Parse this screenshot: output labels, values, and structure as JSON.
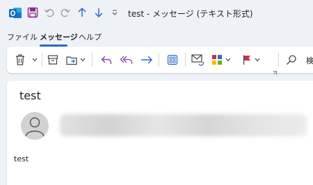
{
  "window": {
    "title": "test  -  メッセージ (テキスト形式)"
  },
  "quick_access": {
    "icons": [
      "outlook-icon",
      "save-icon",
      "undo-icon",
      "redo-icon",
      "arrow-up-icon",
      "arrow-down-icon",
      "customize-dropdown-icon"
    ]
  },
  "menu": {
    "items": [
      {
        "label": "ファイル",
        "active": false
      },
      {
        "label": "メッセージ",
        "active": true
      },
      {
        "label": "ヘルプ",
        "active": false
      }
    ]
  },
  "ribbon": {
    "search_label": "検索",
    "icons": [
      "delete-icon",
      "archive-icon",
      "move-icon",
      "reply-icon",
      "reply-all-icon",
      "forward-icon",
      "apps-icon",
      "mark-unread-icon",
      "categorize-icon",
      "flag-icon",
      "search-icon"
    ]
  },
  "message": {
    "subject": "test",
    "body": "test"
  },
  "colors": {
    "accent": "#2b69c4",
    "outlook_blue": "#0f6cbd",
    "save_purple": "#8b2a8b",
    "reply_purple": "#8a3fb5",
    "flag_red": "#c4314b"
  }
}
